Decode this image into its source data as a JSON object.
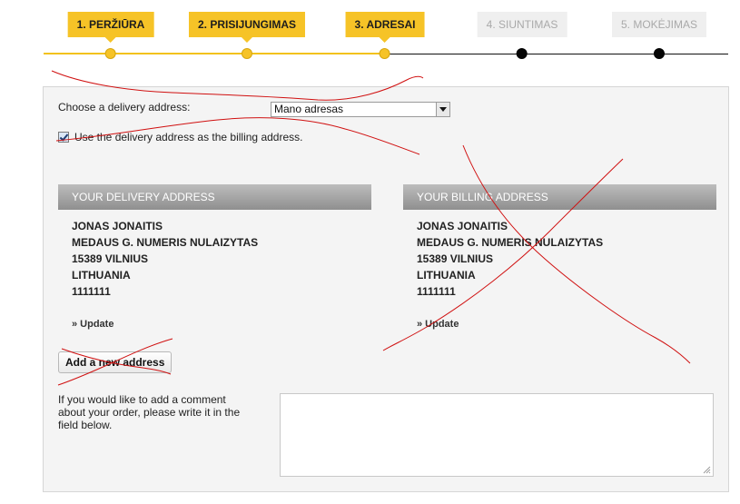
{
  "steps": [
    {
      "label": "1. PERŽIŪRA",
      "state": "active"
    },
    {
      "label": "2. PRISIJUNGIMAS",
      "state": "active"
    },
    {
      "label": "3. ADRESAI",
      "state": "active"
    },
    {
      "label": "4. SIUNTIMAS",
      "state": "inactive"
    },
    {
      "label": "5. MOKĖJIMAS",
      "state": "inactive"
    }
  ],
  "delivery_select": {
    "label": "Choose a delivery address:",
    "selected": "Mano adresas"
  },
  "billing_checkbox": {
    "label": "Use the delivery address as the billing address.",
    "checked": true
  },
  "delivery_address": {
    "header": "YOUR DELIVERY ADDRESS",
    "name": "JONAS JONAITIS",
    "street": "MEDAUS G. NUMERIS NULAIZYTAS",
    "city": "15389 VILNIUS",
    "country": "LITHUANIA",
    "phone": "1111111",
    "update_label": "» Update"
  },
  "billing_address": {
    "header": "YOUR BILLING ADDRESS",
    "name": "JONAS JONAITIS",
    "street": "MEDAUS G. NUMERIS NULAIZYTAS",
    "city": "15389 VILNIUS",
    "country": "LITHUANIA",
    "phone": "1111111",
    "update_label": "» Update"
  },
  "add_address_button": "Add a new address",
  "comment": {
    "instruction": "If you would like to add a comment about your order, please write it in the field below.",
    "value": ""
  },
  "colors": {
    "accent": "#f6c327",
    "inactive_step": "#efefef",
    "annotation": "#d01010"
  }
}
